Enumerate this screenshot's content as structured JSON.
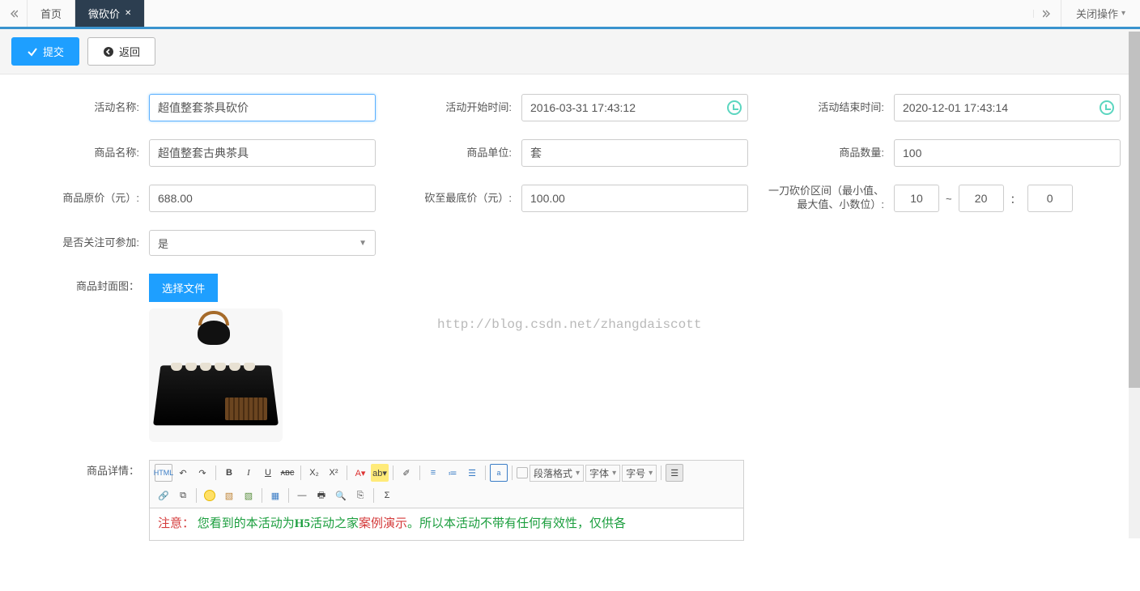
{
  "tabs": {
    "home": "首页",
    "active": "微砍价",
    "close_op": "关闭操作"
  },
  "buttons": {
    "submit": "提交",
    "back": "返回",
    "choose_file": "选择文件"
  },
  "labels": {
    "activity_name": "活动名称:",
    "start_time": "活动开始时间:",
    "end_time": "活动结束时间:",
    "product_name": "商品名称:",
    "product_unit": "商品单位:",
    "product_qty": "商品数量:",
    "orig_price": "商品原价（元）:",
    "floor_price": "砍至最底价（元）:",
    "bargain_range": "一刀砍价区间（最小值、最大值、小数位）:",
    "follow_required": "是否关注可参加:",
    "cover_image": "商品封面图：",
    "product_detail": "商品详情："
  },
  "values": {
    "activity_name": "超值整套茶具砍价",
    "start_time": "2016-03-31 17:43:12",
    "end_time": "2020-12-01 17:43:14",
    "product_name": "超值整套古典茶具",
    "product_unit": "套",
    "product_qty": "100",
    "orig_price": "688.00",
    "floor_price": "100.00",
    "brg_min": "10",
    "brg_max": "20",
    "brg_dec": "0",
    "follow_required": "是"
  },
  "editor_selects": {
    "para": "段落格式",
    "font": "字体",
    "size": "字号"
  },
  "editor_content": {
    "p1a": "注意：",
    "p1b": "您看到的本活动为",
    "p1c": "H5",
    "p1d": "活动之家",
    "p1e": "案例演示",
    "p1f": "。所以本活动不带有任何有效性，仅供各"
  },
  "watermark": "http://blog.csdn.net/zhangdaiscott"
}
